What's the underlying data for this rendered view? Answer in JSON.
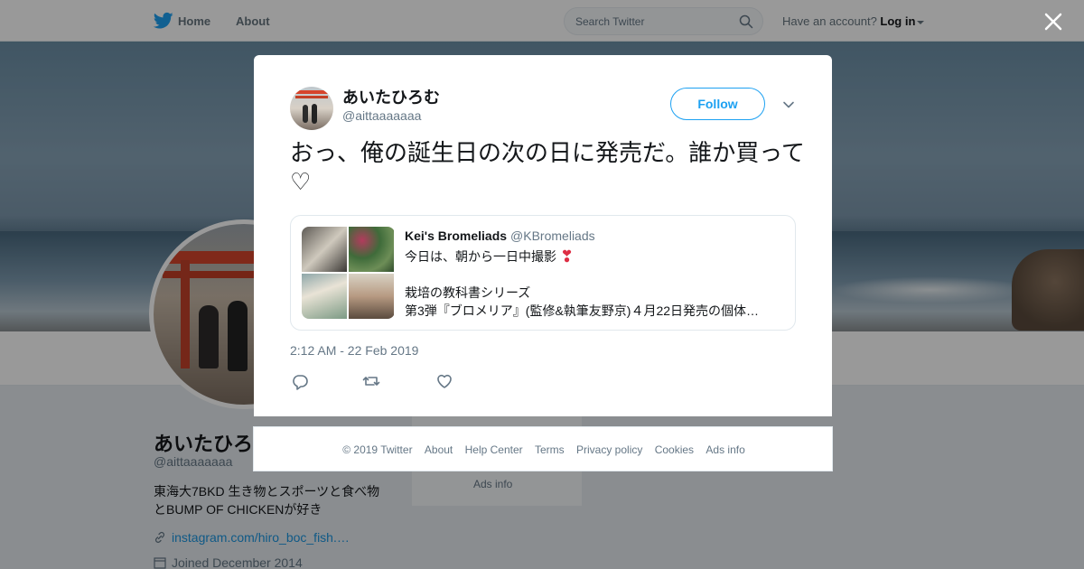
{
  "nav": {
    "home_label": "Home",
    "about_label": "About",
    "search_placeholder": "Search Twitter",
    "have_account": "Have an account?",
    "login_label": "Log in"
  },
  "profile": {
    "name": "あいたひろ",
    "handle": "@aittaaaaaaa",
    "bio": "東海大7BKD 生き物とスポーツと食べ物とBUMP OF CHICKENが好き",
    "link": "instagram.com/hiro_boc_fish.…",
    "joined": "Joined December 2014"
  },
  "side": {
    "ads_info": "Ads info"
  },
  "tweet": {
    "author_name": "あいたひろむ",
    "author_handle": "@aittaaaaaaa",
    "follow_label": "Follow",
    "text": "おっ、俺の誕生日の次の日に発売だ。誰か買って♡",
    "quote": {
      "author_name": "Kei's Bromeliads",
      "author_handle": "@KBromeliads",
      "line1": "今日は、朝から一日中撮影",
      "line2": "栽培の教科書シリーズ",
      "line3": "第3弾『ブロメリア』(監修&執筆友野京)４月22日発売の個体…"
    },
    "timestamp": "2:12 AM - 22 Feb 2019"
  },
  "footer": {
    "copyright": "© 2019 Twitter",
    "links": [
      "About",
      "Help Center",
      "Terms",
      "Privacy policy",
      "Cookies",
      "Ads info"
    ]
  },
  "colors": {
    "accent": "#1da1f2",
    "link": "#1b95e0",
    "muted": "#657786"
  },
  "icons": [
    "twitter-bird-icon",
    "search-icon",
    "close-icon",
    "chevron-down-icon",
    "reply-icon",
    "retweet-icon",
    "like-icon",
    "heart-emoji-icon",
    "link-icon",
    "calendar-icon"
  ]
}
